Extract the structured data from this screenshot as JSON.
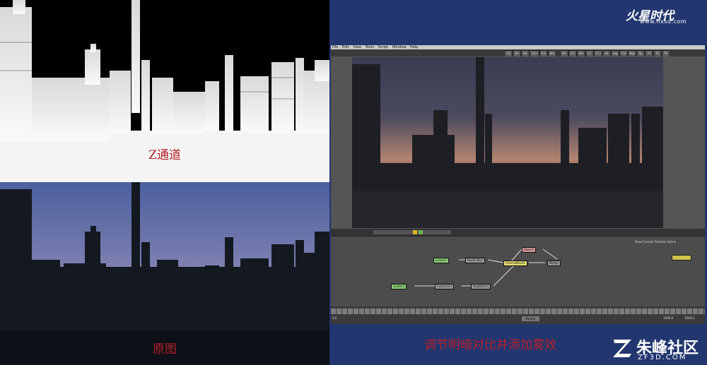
{
  "panels": {
    "depth_label": "Z通道",
    "original_label": "原图",
    "result_label": "调节明暗对比并添加雾效"
  },
  "brand": {
    "top_logo": "火星时代",
    "top_url": "www.hxsd.com",
    "bottom_name": "朱峰社区",
    "bottom_url": "ZF3D.COM"
  },
  "app": {
    "menu": [
      "File",
      "Edit",
      "View",
      "Tools",
      "Script",
      "Window",
      "Help"
    ],
    "toolbar_buttons": [
      "LD",
      "Sh",
      "BG",
      "Txt+",
      "ICk",
      "Bm",
      "Blr",
      "CCl",
      "Bol",
      "CC",
      "CCv",
      "Hl",
      "Log",
      "FLU",
      "Bop",
      "Sp",
      "Pl",
      "Fh",
      "Plr"
    ],
    "nodes": [
      "Loader1",
      "Depth Blur",
      "ChannelBool1",
      "Merge",
      "Saver1",
      "Loader2",
      "ColorCorr1",
      "BrightCon1"
    ],
    "right_tabs": [
      "Flow",
      "Console",
      "Timeline",
      "Spline"
    ],
    "timeline_values": [
      "0.0",
      "1000.0",
      "1000.0"
    ],
    "render_label": "Render"
  }
}
